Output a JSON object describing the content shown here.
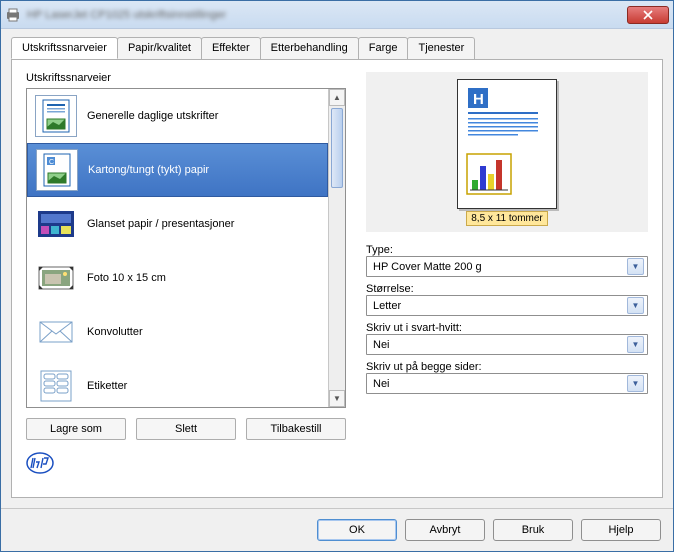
{
  "window": {
    "title": "HP LaserJet CP1025 utskriftsinnstillinger"
  },
  "tabs": [
    {
      "label": "Utskriftssnarveier"
    },
    {
      "label": "Papir/kvalitet"
    },
    {
      "label": "Effekter"
    },
    {
      "label": "Etterbehandling"
    },
    {
      "label": "Farge"
    },
    {
      "label": "Tjenester"
    }
  ],
  "left": {
    "heading": "Utskriftssnarveier",
    "items": [
      {
        "label": "Generelle daglige utskrifter"
      },
      {
        "label": "Kartong/tungt (tykt) papir"
      },
      {
        "label": "Glanset papir / presentasjoner"
      },
      {
        "label": "Foto 10 x 15 cm"
      },
      {
        "label": "Konvolutter"
      },
      {
        "label": "Etiketter"
      }
    ],
    "buttons": {
      "save_as": "Lagre som",
      "delete": "Slett",
      "reset": "Tilbakestill"
    }
  },
  "preview": {
    "dimensions": "8,5 x 11 tommer"
  },
  "fields": {
    "type": {
      "label": "Type:",
      "value": "HP Cover Matte 200 g"
    },
    "size": {
      "label": "Størrelse:",
      "value": "Letter"
    },
    "bw": {
      "label": "Skriv ut i svart-hvitt:",
      "value": "Nei"
    },
    "duplex": {
      "label": "Skriv ut på begge sider:",
      "value": "Nei"
    }
  },
  "footer": {
    "ok": "OK",
    "cancel": "Avbryt",
    "apply": "Bruk",
    "help": "Hjelp"
  }
}
